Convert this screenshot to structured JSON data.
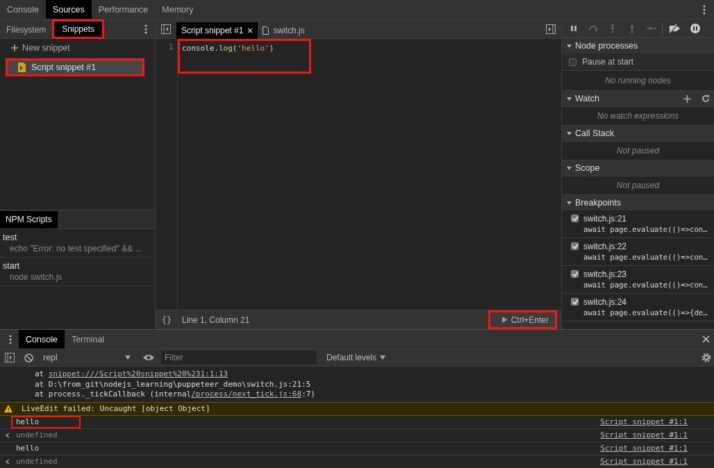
{
  "main_tabs": [
    {
      "label": "Console",
      "selected": false
    },
    {
      "label": "Sources",
      "selected": true
    },
    {
      "label": "Performance",
      "selected": false
    },
    {
      "label": "Memory",
      "selected": false
    }
  ],
  "navigator": {
    "tabs": [
      {
        "label": "Filesystem",
        "selected": false,
        "highlighted": false
      },
      {
        "label": "Snippets",
        "selected": true,
        "highlighted": true
      }
    ],
    "new_snippet": "New snippet",
    "snippets": [
      {
        "name": "Script snippet #1",
        "selected": true,
        "highlighted": true
      }
    ]
  },
  "npm_scripts": {
    "tab": "NPM Scripts",
    "scripts": [
      {
        "name": "test",
        "command": "echo \"Error: no test specified\" && ..."
      },
      {
        "name": "start",
        "command": "node switch.js"
      }
    ]
  },
  "editor": {
    "highlighted": true,
    "tabs": [
      {
        "label": "Script snippet #1",
        "kind": "snippet",
        "selected": true
      },
      {
        "label": "switch.js",
        "kind": "file",
        "selected": false
      }
    ],
    "lines": [
      {
        "number": "1",
        "tokens": [
          {
            "text": "console.",
            "kind": "plain"
          },
          {
            "text": "log",
            "kind": "property"
          },
          {
            "text": "(",
            "kind": "plain"
          },
          {
            "text": "'hello'",
            "kind": "string"
          },
          {
            "text": ")",
            "kind": "plain"
          }
        ]
      }
    ],
    "format_button": "{}",
    "status": "Line 1, Column 21",
    "run_button": {
      "label": "Ctrl+Enter",
      "highlighted": true
    }
  },
  "debugger": {
    "sections": [
      {
        "title": "Node processes",
        "expanded": true,
        "kind": "processes",
        "checkbox": {
          "label": "Pause at start",
          "checked": false
        },
        "empty": "No running nodes"
      },
      {
        "title": "Watch",
        "expanded": true,
        "kind": "watch",
        "empty": "No watch expressions"
      },
      {
        "title": "Call Stack",
        "expanded": true,
        "kind": "empty",
        "empty": "Not paused"
      },
      {
        "title": "Scope",
        "expanded": true,
        "kind": "empty",
        "empty": "Not paused"
      },
      {
        "title": "Breakpoints",
        "expanded": true,
        "kind": "breakpoints",
        "breakpoints": [
          {
            "location": "switch.js:21",
            "code": "await page.evaluate(()=>con…",
            "checked": true
          },
          {
            "location": "switch.js:22",
            "code": "await page.evaluate(()=>con…",
            "checked": true
          },
          {
            "location": "switch.js:23",
            "code": "await page.evaluate(()=>con…",
            "checked": true
          },
          {
            "location": "switch.js:24",
            "code": "await page.evaluate(()=>{de…",
            "checked": true
          }
        ]
      }
    ]
  },
  "drawer": {
    "tabs": [
      {
        "label": "Console",
        "selected": true
      },
      {
        "label": "Terminal",
        "selected": false
      }
    ],
    "context": "repl",
    "filter_placeholder": "Filter",
    "levels": "Default levels",
    "messages": [
      {
        "kind": "stack",
        "prefix": "at ",
        "link": "snippet:///Script%20snippet%20%231:1:13"
      },
      {
        "kind": "stack",
        "prefix": "at D:\\from_git\\nodejs_learning\\puppeteer_demo\\switch.js:21:5"
      },
      {
        "kind": "stack",
        "prefix": "at process._tickCallback (internal",
        "link": "/process/next_tick.js:68",
        "suffix": ":7)"
      },
      {
        "kind": "warning",
        "text": "LiveEdit failed: Uncaught [object Object]"
      },
      {
        "kind": "log",
        "text": "hello",
        "source": "Script snippet #1:1",
        "highlighted": true
      },
      {
        "kind": "result",
        "text": "undefined",
        "source": "Script snippet #1:1",
        "highlighted": false
      },
      {
        "kind": "log",
        "text": "hello",
        "source": "Script snippet #1:1",
        "highlighted": false
      },
      {
        "kind": "result",
        "text": "undefined",
        "source": "Script snippet #1:1",
        "highlighted": false
      }
    ]
  }
}
